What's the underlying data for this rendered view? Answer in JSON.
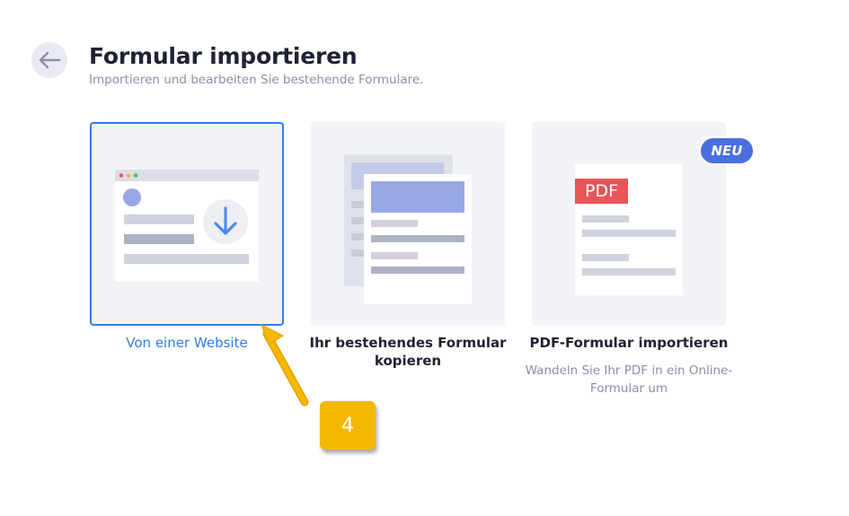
{
  "header": {
    "title": "Formular importieren",
    "subtitle": "Importieren und bearbeiten Sie bestehende Formulare."
  },
  "options": [
    {
      "label": "Von einer Website",
      "selected": true
    },
    {
      "label": "Ihr bestehendes Formular kopieren",
      "selected": false
    },
    {
      "label": "PDF-Formular importieren",
      "description": "Wandeln Sie Ihr PDF in ein Online-Formular um",
      "selected": false
    }
  ],
  "pdf_tag": "PDF",
  "badge": "NEU",
  "callout": "4",
  "icons": [
    "back-arrow-icon",
    "download-icon",
    "copy-form-illustration",
    "pdf-document-illustration",
    "pointer-arrow"
  ],
  "colors": {
    "accent": "#2f7ee6",
    "badge": "#4a6fde",
    "pdf": "#e8565a",
    "callout": "#f5b800"
  }
}
